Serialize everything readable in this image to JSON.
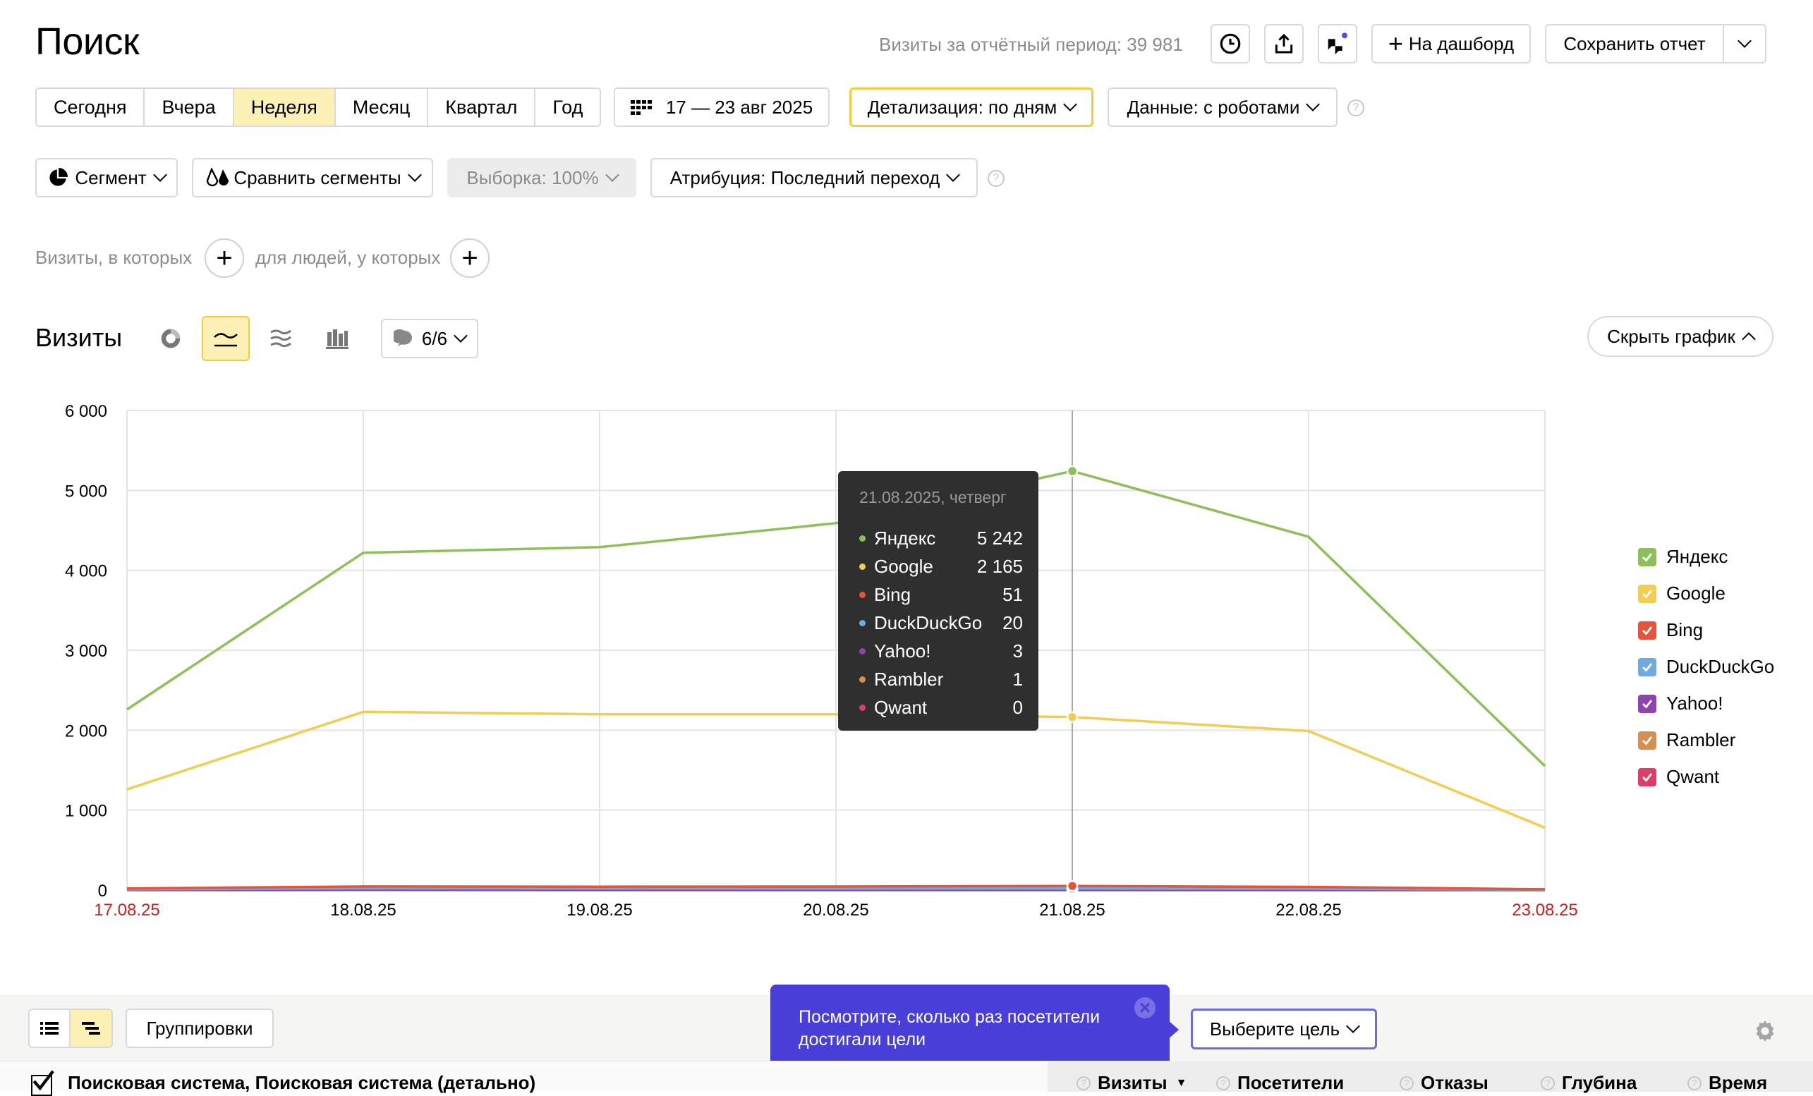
{
  "header": {
    "title": "Поиск",
    "visits_total": "Визиты за отчётный период: 39 981",
    "to_dashboard_label": "На дашборд",
    "save_report_label": "Сохранить отчет",
    "icons": [
      "history-icon",
      "export-icon",
      "chat-bot-icon",
      "chevron-down-icon"
    ]
  },
  "period": {
    "options": [
      "Сегодня",
      "Вчера",
      "Неделя",
      "Месяц",
      "Квартал",
      "Год"
    ],
    "active": "Неделя",
    "date_range": "17 — 23 авг 2025",
    "detail_label": "Детализация: по дням",
    "data_label": "Данные: с роботами",
    "help_glyph": "?"
  },
  "filters": {
    "segment_label": "Сегмент",
    "compare_label": "Сравнить сегменты",
    "sample_label": "Выборка: 100%",
    "attribution_label": "Атрибуция: Последний переход"
  },
  "conditions": {
    "visits_where": "Визиты, в которых",
    "people_where": "для людей, у которых",
    "plus_glyph": "+"
  },
  "chart_panel": {
    "title": "Визиты",
    "metrics_label": "6/6",
    "hide_chart_label": "Скрыть график",
    "chart_type_icons": [
      "pie-chart-icon",
      "line-chart-icon",
      "area-chart-icon",
      "bar-chart-icon"
    ],
    "active_chart_type": "line-chart-icon"
  },
  "chart_data": {
    "type": "line",
    "x": [
      "17.08.25",
      "18.08.25",
      "19.08.25",
      "20.08.25",
      "21.08.25",
      "22.08.25",
      "23.08.25"
    ],
    "weekend_x": [
      "17.08.25",
      "23.08.25"
    ],
    "ylim": [
      0,
      6000
    ],
    "yticks": [
      "0",
      "1 000",
      "2 000",
      "3 000",
      "4 000",
      "5 000",
      "6 000"
    ],
    "grid": true,
    "legend_position": "right",
    "series": [
      {
        "name": "Яндекс",
        "color": "#8ec05a",
        "values": [
          2260,
          4220,
          4290,
          4590,
          5242,
          4420,
          1550
        ]
      },
      {
        "name": "Google",
        "color": "#f3cd51",
        "values": [
          1260,
          2230,
          2200,
          2200,
          2165,
          1990,
          780
        ]
      },
      {
        "name": "Bing",
        "color": "#e4553c",
        "values": [
          20,
          45,
          42,
          44,
          51,
          40,
          10
        ]
      },
      {
        "name": "DuckDuckGo",
        "color": "#71aadf",
        "values": [
          10,
          22,
          21,
          19,
          20,
          18,
          5
        ]
      },
      {
        "name": "Yahoo!",
        "color": "#8f44ad",
        "values": [
          2,
          4,
          3,
          3,
          3,
          2,
          1
        ]
      },
      {
        "name": "Rambler",
        "color": "#d48f55",
        "values": [
          1,
          2,
          1,
          1,
          1,
          1,
          0
        ]
      },
      {
        "name": "Qwant",
        "color": "#dd3e66",
        "values": [
          0,
          1,
          0,
          0,
          0,
          0,
          0
        ]
      }
    ],
    "tooltip": {
      "date": "21.08.2025, четверг",
      "x_index": 4,
      "rows": [
        {
          "name": "Яндекс",
          "value": "5 242"
        },
        {
          "name": "Google",
          "value": "2 165"
        },
        {
          "name": "Bing",
          "value": "51"
        },
        {
          "name": "DuckDuckGo",
          "value": "20"
        },
        {
          "name": "Yahoo!",
          "value": "3"
        },
        {
          "name": "Rambler",
          "value": "1"
        },
        {
          "name": "Qwant",
          "value": "0"
        }
      ]
    }
  },
  "table_toolbar": {
    "groupings_label": "Группировки",
    "goal_label": "Выберите цель",
    "popup_text_1": "Посмотрите, сколько раз посетители",
    "popup_text_2": "достигали цели",
    "close_glyph": "×"
  },
  "table_header": {
    "dimension": "Поисковая система, Поисковая система (детально)",
    "columns": [
      "Визиты",
      "Посетители",
      "Отказы",
      "Глубина",
      "Время"
    ],
    "sort_glyph": "▼"
  }
}
